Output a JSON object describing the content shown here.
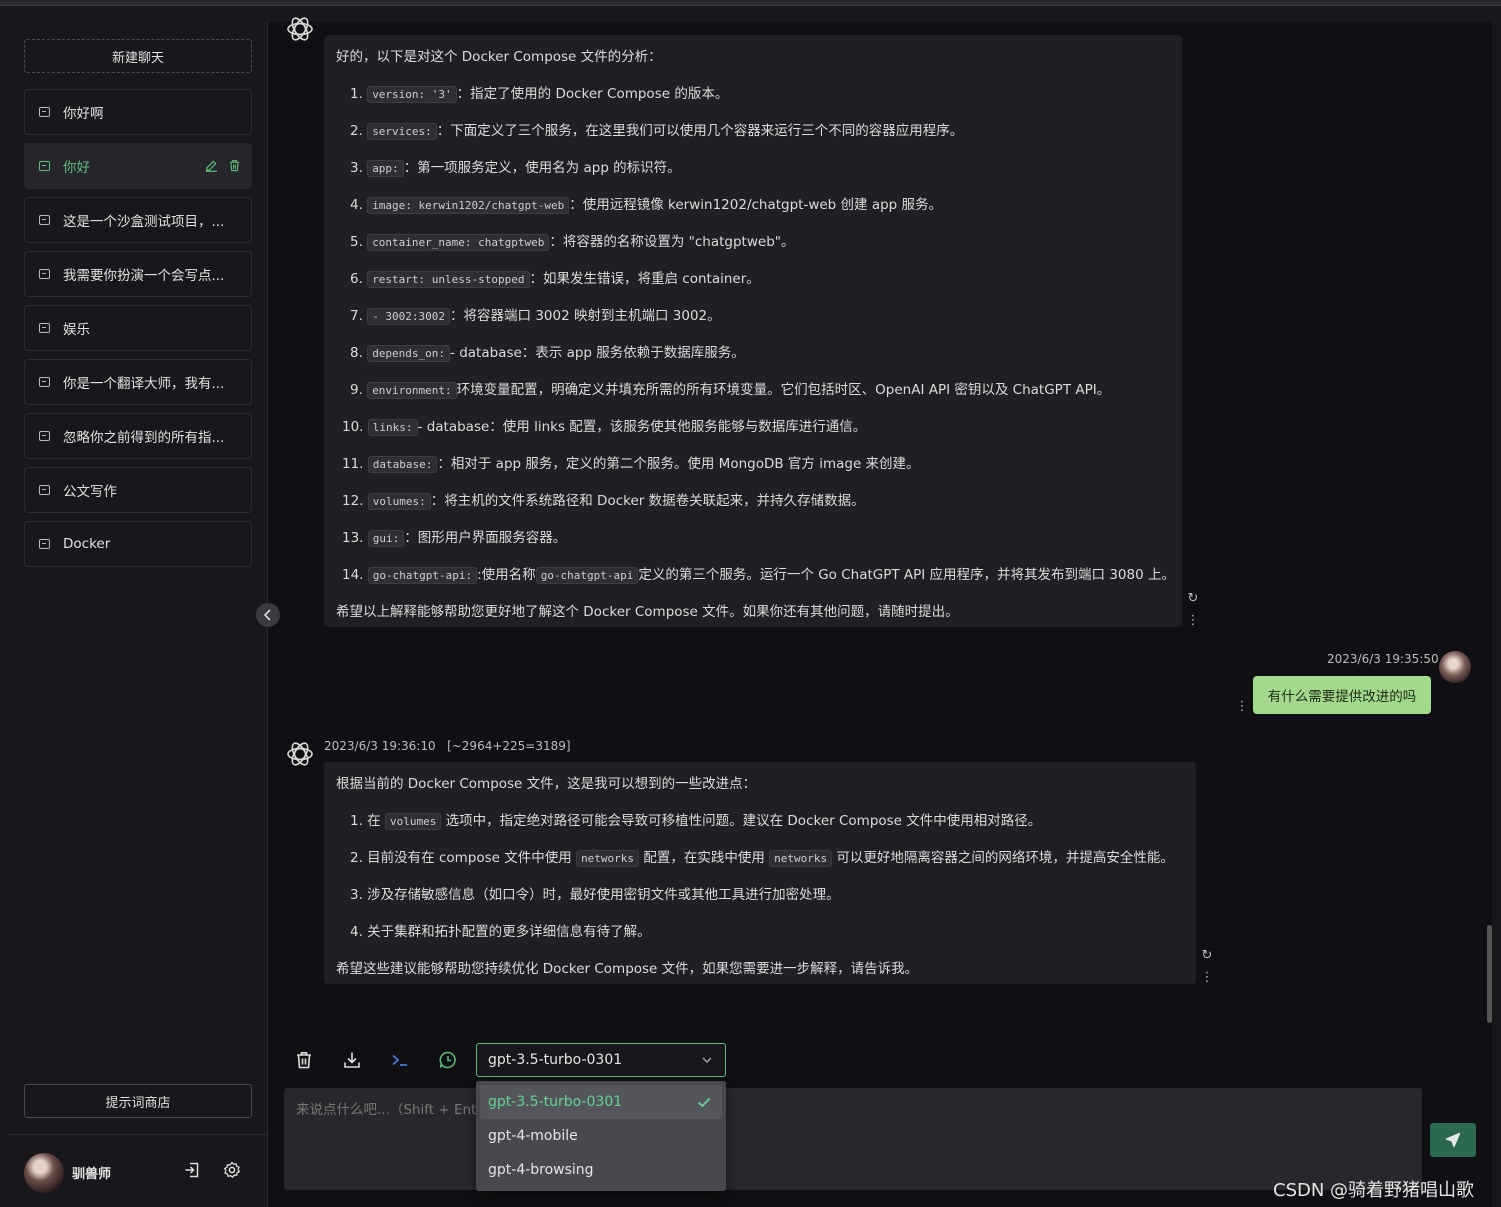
{
  "sidebar": {
    "new_chat": "新建聊天",
    "items": [
      {
        "label": "你好啊"
      },
      {
        "label": "你好"
      },
      {
        "label": "这是一个沙盒测试项目，..."
      },
      {
        "label": "我需要你扮演一个会写点..."
      },
      {
        "label": "娱乐"
      },
      {
        "label": "你是一个翻译大师，我有..."
      },
      {
        "label": "忽略你之前得到的所有指..."
      },
      {
        "label": "公文写作"
      },
      {
        "label": "Docker"
      }
    ],
    "prompt_store": "提示词商店",
    "username": "驯兽师"
  },
  "messages": {
    "first": {
      "intro": "好的，以下是对这个 Docker Compose 文件的分析：",
      "items": [
        {
          "num": "1.",
          "code": "version: '3'",
          "text": "：指定了使用的 Docker Compose 的版本。"
        },
        {
          "num": "2.",
          "code": "services:",
          "text": "：下面定义了三个服务，在这里我们可以使用几个容器来运行三个不同的容器应用程序。"
        },
        {
          "num": "3.",
          "code": "app:",
          "text": "：第一项服务定义，使用名为 app 的标识符。"
        },
        {
          "num": "4.",
          "code": "image: kerwin1202/chatgpt-web",
          "text": "：使用远程镜像 kerwin1202/chatgpt-web 创建 app 服务。"
        },
        {
          "num": "5.",
          "code": "container_name: chatgptweb",
          "text": "：将容器的名称设置为 \"chatgptweb\"。"
        },
        {
          "num": "6.",
          "code": "restart: unless-stopped",
          "text": "：如果发生错误，将重启 container。"
        },
        {
          "num": "7.",
          "code": "- 3002:3002",
          "text": "：将容器端口 3002 映射到主机端口 3002。"
        },
        {
          "num": "8.",
          "code": "depends_on:",
          "text": "- database：表示 app 服务依赖于数据库服务。"
        },
        {
          "num": "9.",
          "code": "environment:",
          "text": "环境变量配置，明确定义并填充所需的所有环境变量。它们包括时区、OpenAI API 密钥以及 ChatGPT API。"
        },
        {
          "num": "10.",
          "code": "links:",
          "text": "- database：使用 links 配置，该服务使其他服务能够与数据库进行通信。"
        },
        {
          "num": "11.",
          "code": "database:",
          "text": "：相对于 app 服务，定义的第二个服务。使用 MongoDB 官方 image 来创建。"
        },
        {
          "num": "12.",
          "code": "volumes:",
          "text": "：将主机的文件系统路径和 Docker 数据卷关联起来，并持久存储数据。"
        },
        {
          "num": "13.",
          "code": "gui:",
          "text": "：图形用户界面服务容器。"
        },
        {
          "num": "14.",
          "code": "go-chatgpt-api:",
          "text": ":使用名称",
          "code2": "go-chatgpt-api",
          "text2": "定义的第三个服务。运行一个 Go ChatGPT API 应用程序，并将其发布到端口 3080 上。"
        }
      ],
      "outro": "希望以上解释能够帮助您更好地了解这个 Docker Compose 文件。如果你还有其他问题，请随时提出。"
    },
    "user": {
      "time": "2023/6/3 19:35:50",
      "text": "有什么需要提供改进的吗"
    },
    "second": {
      "time": "2023/6/3 19:36:10",
      "tokens": "[~2964+225=3189]",
      "intro": "根据当前的 Docker Compose 文件，这是我可以想到的一些改进点：",
      "i1_pre": "1. 在",
      "i1_code": "volumes",
      "i1_post": "选项中，指定绝对路径可能会导致可移植性问题。建议在 Docker Compose 文件中使用相对路径。",
      "i2_pre": "2. 目前没有在 compose 文件中使用",
      "i2_code": "networks",
      "i2_mid": "配置，在实践中使用",
      "i2_code2": "networks",
      "i2_post": "可以更好地隔离容器之间的网络环境，并提高安全性能。",
      "i3": "3. 涉及存储敏感信息（如口令）时，最好使用密钥文件或其他工具进行加密处理。",
      "i4": "4. 关于集群和拓扑配置的更多详细信息有待了解。",
      "outro": "希望这些建议能够帮助您持续优化 Docker Compose 文件，如果您需要进一步解释，请告诉我。"
    }
  },
  "composer": {
    "model": "gpt-3.5-turbo-0301",
    "placeholder": "来说点什么吧...（Shift + Ent",
    "options": [
      "gpt-3.5-turbo-0301",
      "gpt-4-mobile",
      "gpt-4-browsing"
    ]
  },
  "watermark": "CSDN @骑着野猪唱山歌",
  "colors": {
    "accent": "#5fbf78",
    "user_bubble": "#a3d98b",
    "send": "#2c6a4f"
  }
}
